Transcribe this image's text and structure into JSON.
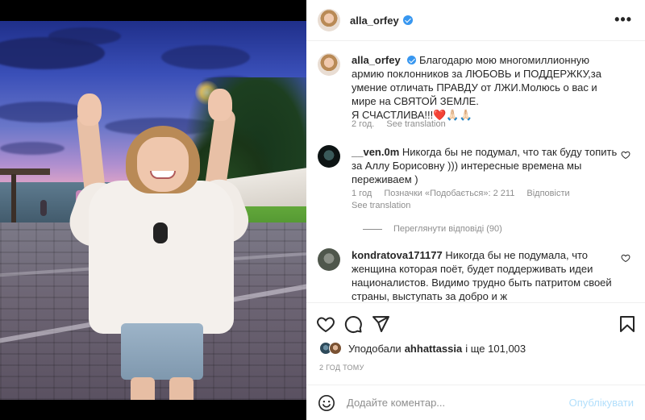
{
  "header": {
    "username": "alla_orfey"
  },
  "caption": {
    "username": "alla_orfey",
    "text": "Благодарю мою многомиллионную армию поклонников за ЛЮБОВЬ и ПОДДЕРЖКУ,за умение отличать ПРАВДУ от ЛЖИ.Молюсь о вас и мире на СВЯТОЙ ЗЕМЛЕ.",
    "text2": "Я СЧАСТЛИВА!!!❤️🙏🏻🙏🏻",
    "age": "2 год.",
    "see_translation": "See translation"
  },
  "comments": [
    {
      "username": "__ven.0m",
      "text": "Никогда бы не подумал, что так буду топить за Аллу Борисовну ))) интересные времена мы переживаем )",
      "age": "1 год",
      "likes": "Позначки «Подобається»: 2 211",
      "reply": "Відповісти",
      "see_translation": "See translation",
      "view_replies": "Переглянути відповіді (90)"
    },
    {
      "username": "kondratova171177",
      "text": "Никогда бы не подумала, что женщина которая поёт, будет поддерживать идеи националистов. Видимо трудно быть патритом своей страны, выступать за добро и ж"
    }
  ],
  "likes_line": {
    "prefix": "Уподобали",
    "user": "ahhattassia",
    "rest": "і ще 101,003"
  },
  "timestamp": "2 ГОД ТОМУ",
  "add_comment": {
    "placeholder": "Додайте коментар...",
    "publish": "Опублікувати"
  },
  "icons": [
    "more-icon",
    "verified-icon",
    "heart-icon",
    "comment-icon",
    "share-icon",
    "bookmark-icon",
    "emoji-icon"
  ],
  "colors": {
    "verified": "#3897f0",
    "muted": "#8e8e8e",
    "publish": "#b2dffc",
    "like_heart": "#ed4956"
  }
}
